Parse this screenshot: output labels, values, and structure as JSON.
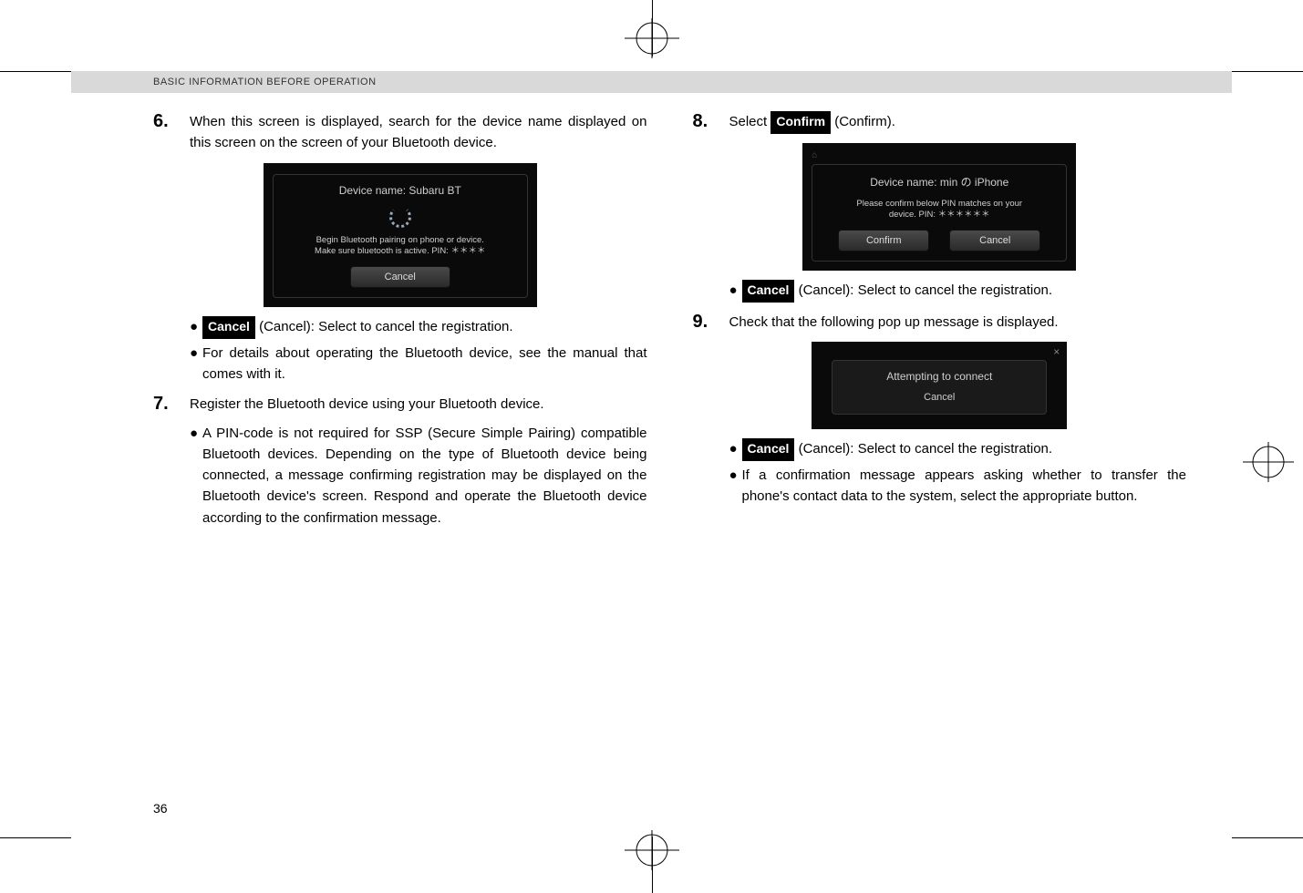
{
  "header": "BASIC INFORMATION BEFORE OPERATION",
  "pageNumber": "36",
  "labels": {
    "cancel": "Cancel",
    "confirm": "Confirm"
  },
  "left": {
    "step6": {
      "num": "6.",
      "text": "When this screen is displayed, search for the device name displayed on this screen on the screen of your Bluetooth device."
    },
    "shot6": {
      "device": "Device name: Subaru BT",
      "hint1": "Begin Bluetooth pairing on phone or device.",
      "hint2": "Make sure bluetooth is active. PIN: ＊＊＊＊",
      "btn": "Cancel"
    },
    "cancelDesc": " (Cancel): Select to cancel the registration.",
    "detailNote": "For details about operating the Bluetooth device, see the manual that comes with it.",
    "step7": {
      "num": "7.",
      "text": "Register the Bluetooth device using your Bluetooth device."
    },
    "pinNote": "A PIN-code is not required for SSP (Secure Simple Pairing) compatible Bluetooth devices. Depending on the type of Bluetooth device being connected, a message confirming registration may be displayed on the Bluetooth device's screen. Respond and operate the Bluetooth device according to the confirmation message."
  },
  "right": {
    "step8": {
      "num": "8.",
      "prefix": "Select ",
      "suffix": " (Confirm)."
    },
    "shot8": {
      "device": "Device name: min の iPhone",
      "hint1": "Please confirm below PIN matches on your",
      "hint2": "device. PIN: ＊＊＊＊＊＊",
      "btnL": "Confirm",
      "btnR": "Cancel"
    },
    "cancelDesc": " (Cancel): Select to cancel the registration.",
    "step9": {
      "num": "9.",
      "text": "Check that the following pop up message is displayed."
    },
    "shot9": {
      "msg": "Attempting to connect",
      "btn": "Cancel"
    },
    "cancel9Desc": " (Cancel): Select to cancel the registration.",
    "confirmNote": "If a confirmation message appears asking whether to transfer the phone's contact data to the system, select the appropriate button."
  }
}
